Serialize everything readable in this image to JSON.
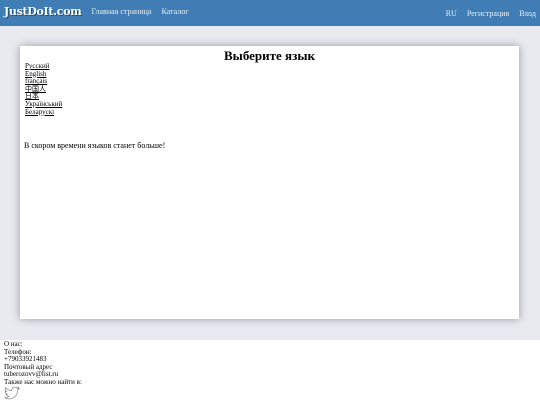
{
  "navbar": {
    "logo": "JustDoIt.com",
    "links": [
      "Главная страница",
      "Каталог"
    ],
    "lang": "RU",
    "register": "Регистрация",
    "login": "Вход"
  },
  "main": {
    "title": "Выберите язык",
    "languages": [
      "Русский",
      "English",
      "français",
      "中国人",
      "日本",
      "Український",
      "Беларускі"
    ],
    "notice": "В скором времени языков станет больше!"
  },
  "footer": {
    "about": "О нас:",
    "phone_label": "Телефон:",
    "phone": "+79033921483",
    "mail_label": "Почтовый адрес",
    "email": "tuberozovv@list.ru",
    "social_label": "Также нас можно найти в:",
    "social_icon": "twitter-icon",
    "icon_color": "#8a8a8a"
  },
  "colors": {
    "navbar": "#3f7db4",
    "page_bg": "#e9e9f0"
  }
}
